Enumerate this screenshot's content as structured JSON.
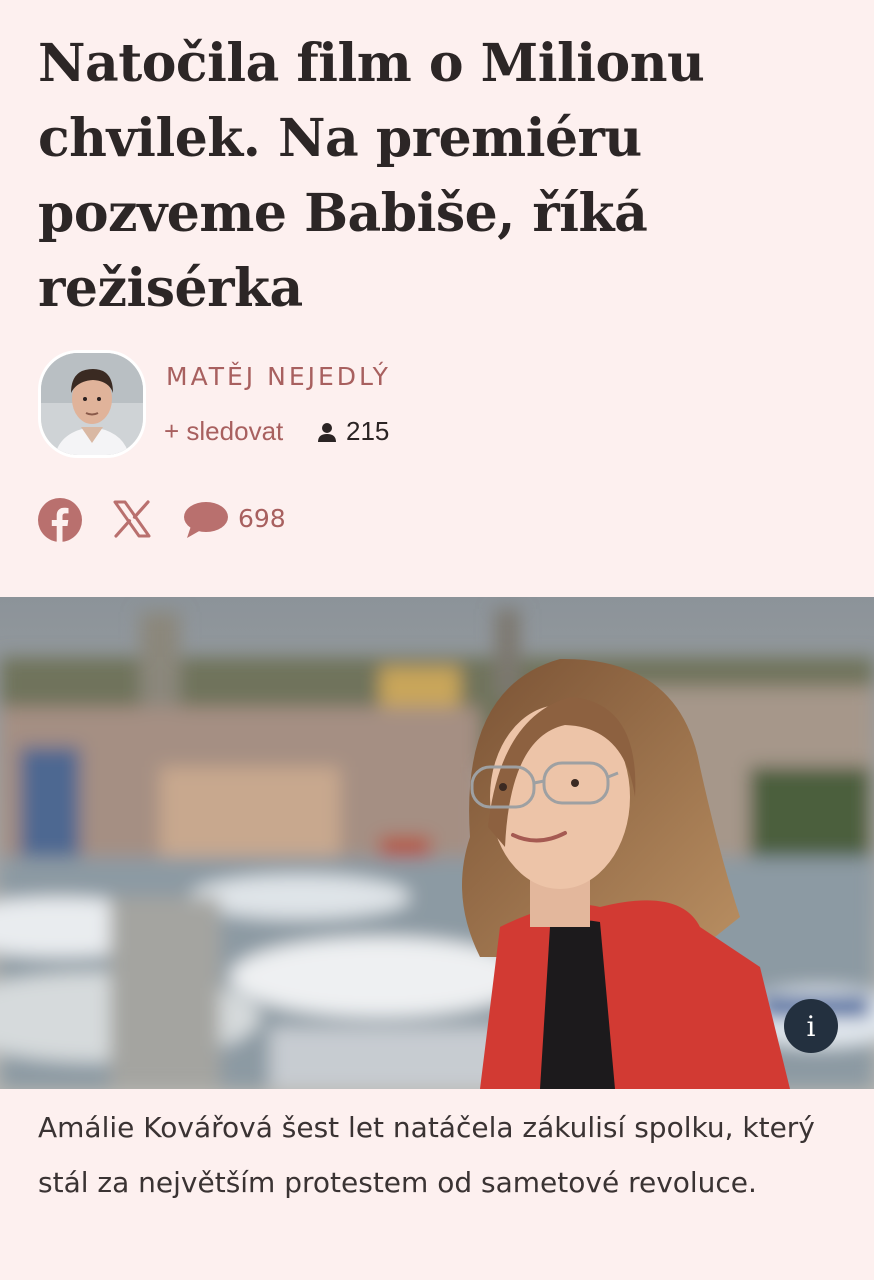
{
  "article": {
    "headline": "Natočila film o Milionu chvilek. Na premiéru pozveme Babiše, říká režisérka"
  },
  "author": {
    "name": "MATĚJ NEJEDLÝ",
    "follow_label": "+ sledovat",
    "followers_count": "215"
  },
  "share": {
    "facebook_icon": "facebook-icon",
    "x_icon": "x-icon",
    "comments_icon": "comment-bubble-icon",
    "comments_count": "698"
  },
  "photo": {
    "info_label": "i",
    "caption": "Amálie Kovářová šest let natáčela zákulisí spolku, který stál za největším protestem od sametové revoluce."
  },
  "colors": {
    "background": "#fdf0ef",
    "accent": "#a8605f",
    "headline": "#2c2626"
  }
}
